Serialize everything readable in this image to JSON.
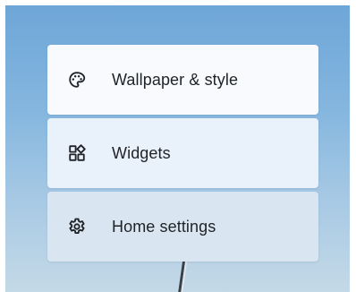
{
  "popup_menu": {
    "items": [
      {
        "label": "Wallpaper & style",
        "icon": "palette-icon"
      },
      {
        "label": "Widgets",
        "icon": "widgets-icon"
      },
      {
        "label": "Home settings",
        "icon": "gear-icon"
      }
    ]
  },
  "colors": {
    "wallpaper_top": "#6da6d8",
    "wallpaper_bottom": "#c4d9e7",
    "item_1_background": "#f8fafd",
    "item_2_background": "#e9f1fb",
    "item_3_background": "#d9e5f0",
    "text": "#1f2327"
  }
}
